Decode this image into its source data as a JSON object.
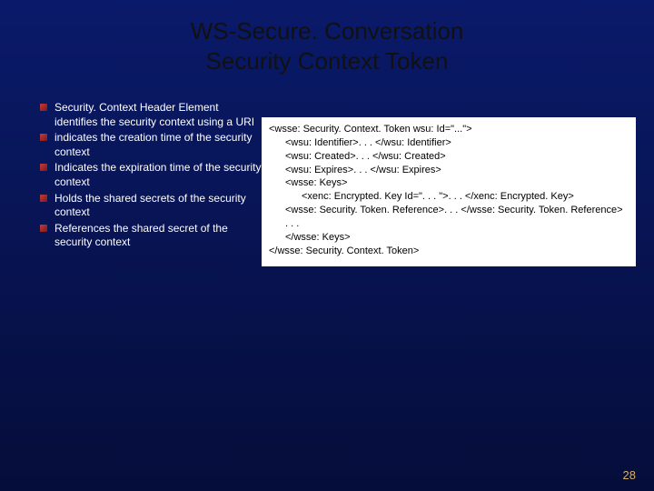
{
  "title_line1": "WS-Secure. Conversation",
  "title_line2": "Security Context Token",
  "bullets": [
    "Security. Context Header Element identifies the security context using a URI",
    "indicates the creation time of the security context",
    "Indicates the expiration time of the security context",
    "Holds the shared secrets of the security context",
    "References the shared secret of the security context"
  ],
  "code": {
    "l1": "<wsse: Security. Context. Token wsu: Id=\"...\">",
    "l2": "<wsu: Identifier>. . . </wsu: Identifier>",
    "l3": "<wsu: Created>. . . </wsu: Created>",
    "l4": "<wsu: Expires>. . . </wsu: Expires>",
    "l5": "<wsse: Keys>",
    "l6": "<xenc: Encrypted. Key Id=\". . . \">. . . </xenc: Encrypted. Key>",
    "l7": "<wsse: Security. Token. Reference>. . . </wsse: Security. Token. Reference>",
    "l8": ". . .",
    "l9": "</wsse: Keys>",
    "l10": "</wsse: Security. Context. Token>"
  },
  "page_number": "28"
}
